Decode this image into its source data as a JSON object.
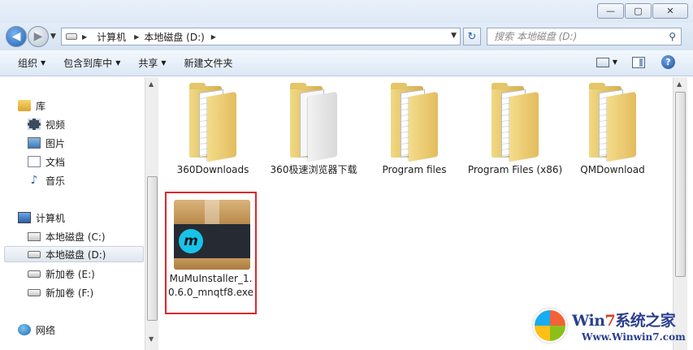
{
  "window": {
    "minimize_glyph": "—",
    "maximize_glyph": "▢",
    "close_glyph": "✕"
  },
  "address": {
    "crumbs": [
      "计算机",
      "本地磁盘 (D:)"
    ],
    "dropdown_glyph": "▼"
  },
  "search": {
    "placeholder": "搜索 本地磁盘 (D:)"
  },
  "toolbar": {
    "organize": "组织",
    "include_in_library": "包含到库中",
    "share": "共享",
    "new_folder": "新建文件夹"
  },
  "nav": {
    "libraries": "库",
    "videos": "视频",
    "pictures": "图片",
    "documents": "文档",
    "music": "音乐",
    "computer": "计算机",
    "drive_c": "本地磁盘 (C:)",
    "drive_d": "本地磁盘 (D:)",
    "drive_e": "新加卷 (E:)",
    "drive_f": "新加卷 (F:)",
    "network": "网络"
  },
  "files": [
    {
      "name": "360Downloads"
    },
    {
      "name": "360极速浏览器下载"
    },
    {
      "name": "Program files"
    },
    {
      "name": "Program Files (x86)"
    },
    {
      "name": "QMDownload"
    },
    {
      "name": "MuMuInstaller_1.0.6.0_mnqtf8.exe"
    }
  ],
  "watermark": {
    "brand_win": "Win",
    "brand_seven": "7",
    "brand_rest": "系统之家",
    "url": "Www.Winwin7.com"
  },
  "colors": {
    "highlight_border": "#e0262b",
    "accent": "#2a64b5"
  }
}
